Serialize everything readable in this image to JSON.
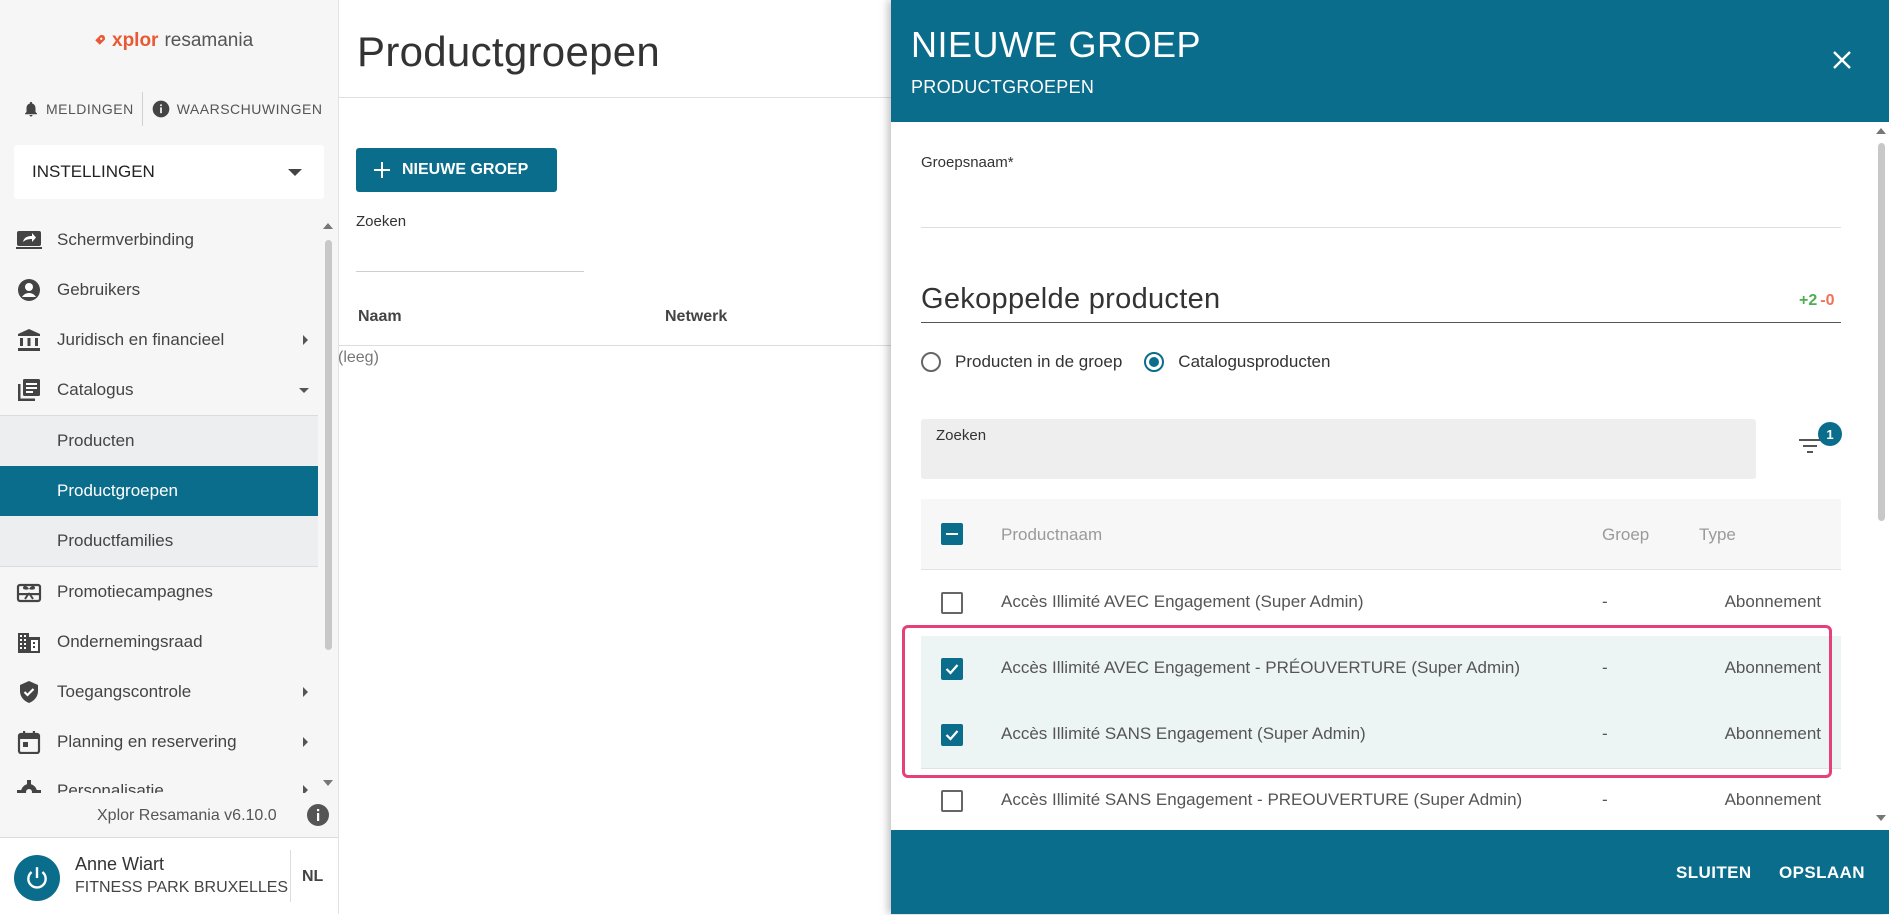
{
  "sidebar": {
    "logo": {
      "brand": "xplor",
      "product": "resamania",
      "brand_color": "#e85a35"
    },
    "alerts": {
      "notifications": "MELDINGEN",
      "warnings": "WAARSCHUWINGEN"
    },
    "section_select": "INSTELLINGEN",
    "nav": [
      {
        "label": "Schermverbinding",
        "icon": "screen-share-icon"
      },
      {
        "label": "Gebruikers",
        "icon": "user-circle-icon"
      },
      {
        "label": "Juridisch en financieel",
        "icon": "bank-icon"
      },
      {
        "label": "Catalogus",
        "icon": "library-books-icon"
      },
      {
        "label": "Producten"
      },
      {
        "label": "Productgroepen"
      },
      {
        "label": "Productfamilies"
      },
      {
        "label": "Promotiecampagnes",
        "icon": "gift-card-icon"
      },
      {
        "label": "Ondernemingsraad",
        "icon": "building-icon"
      },
      {
        "label": "Toegangscontrole",
        "icon": "shield-check-icon"
      },
      {
        "label": "Planning en reservering",
        "icon": "calendar-icon"
      },
      {
        "label": "Personalisatie",
        "icon": "gear-icon"
      }
    ],
    "version": "Xplor Resamania v6.10.0",
    "user": {
      "name": "Anne Wiart",
      "org": "FITNESS PARK BRUXELLES",
      "lang": "NL"
    }
  },
  "main": {
    "title": "Productgroepen",
    "new_group_button": "NIEUWE GROEP",
    "search_label": "Zoeken",
    "columns": [
      "Naam",
      "Netwerk"
    ],
    "empty": "(leeg)"
  },
  "drawer": {
    "title": "NIEUWE GROEP",
    "subtitle": "PRODUCTGROEPEN",
    "group_name_label": "Groepsnaam*",
    "linked_title": "Gekoppelde producten",
    "added_count": "+2",
    "removed_count": "-0",
    "radio_in_group": "Producten in de groep",
    "radio_catalog": "Catalogusproducten",
    "search_label": "Zoeken",
    "filter_count": "1",
    "table_headers": {
      "name": "Productnaam",
      "group": "Groep",
      "type": "Type"
    },
    "rows": [
      {
        "name": "Accès Illimité AVEC Engagement (Super Admin)",
        "group": "-",
        "type": "Abonnement",
        "checked": false
      },
      {
        "name": "Accès Illimité AVEC Engagement - PRÉOUVERTURE (Super Admin)",
        "group": "-",
        "type": "Abonnement",
        "checked": true
      },
      {
        "name": "Accès Illimité SANS Engagement (Super Admin)",
        "group": "-",
        "type": "Abonnement",
        "checked": true
      },
      {
        "name": "Accès Illimité SANS Engagement - PREOUVERTURE (Super Admin)",
        "group": "-",
        "type": "Abonnement",
        "checked": false
      }
    ],
    "close_button": "SLUITEN",
    "save_button": "OPSLAAN"
  },
  "colors": {
    "primary": "#0b6d8c",
    "highlight": "#e5407a",
    "added": "#4caf50",
    "removed": "#f0705a"
  }
}
